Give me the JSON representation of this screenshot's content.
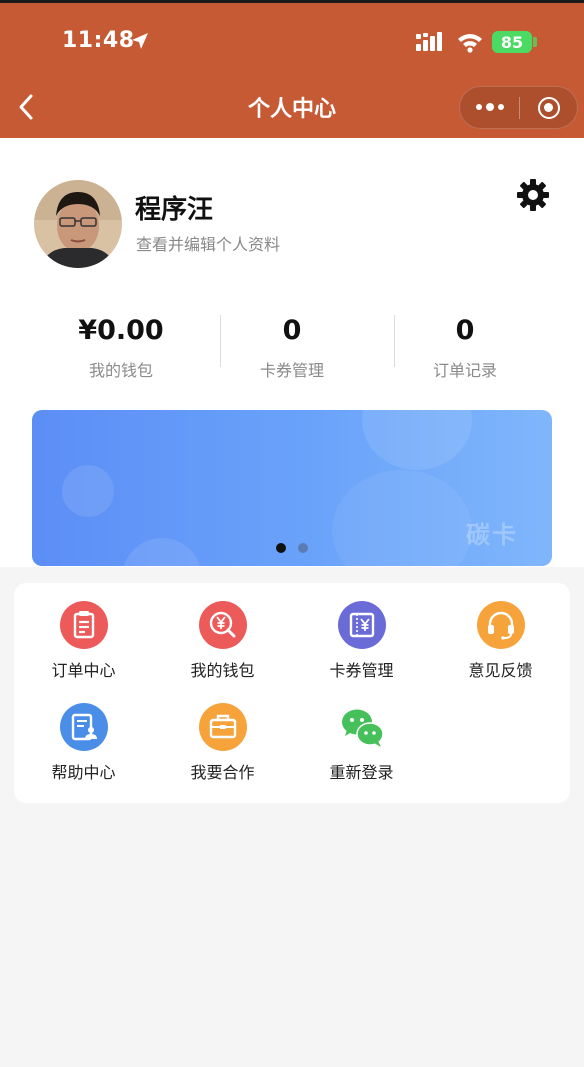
{
  "status_bar": {
    "time": "11:48",
    "battery": "85"
  },
  "nav": {
    "title": "个人中心"
  },
  "profile": {
    "name": "程序汪",
    "subtitle": "查看并编辑个人资料"
  },
  "stats": [
    {
      "value": "¥0.00",
      "label": "我的钱包"
    },
    {
      "value": "0",
      "label": "卡券管理"
    },
    {
      "value": "0",
      "label": "订单记录"
    }
  ],
  "banner": {
    "text": "碳卡",
    "slides": 2,
    "active_slide": 1
  },
  "menu": [
    {
      "label": "订单中心",
      "icon": "clipboard-icon",
      "color": "#ec5a5a"
    },
    {
      "label": "我的钱包",
      "icon": "yuan-search-icon",
      "color": "#ec5a5a"
    },
    {
      "label": "卡券管理",
      "icon": "ticket-icon",
      "color": "#6b6bd8"
    },
    {
      "label": "意见反馈",
      "icon": "headset-icon",
      "color": "#f5a33a"
    },
    {
      "label": "帮助中心",
      "icon": "document-person-icon",
      "color": "#4a8ee8"
    },
    {
      "label": "我要合作",
      "icon": "briefcase-icon",
      "color": "#f5a33a"
    },
    {
      "label": "重新登录",
      "icon": "wechat-icon",
      "color": "#45c05a"
    }
  ],
  "colors": {
    "header": "#c55a34",
    "banner": "#6aa3fa"
  }
}
